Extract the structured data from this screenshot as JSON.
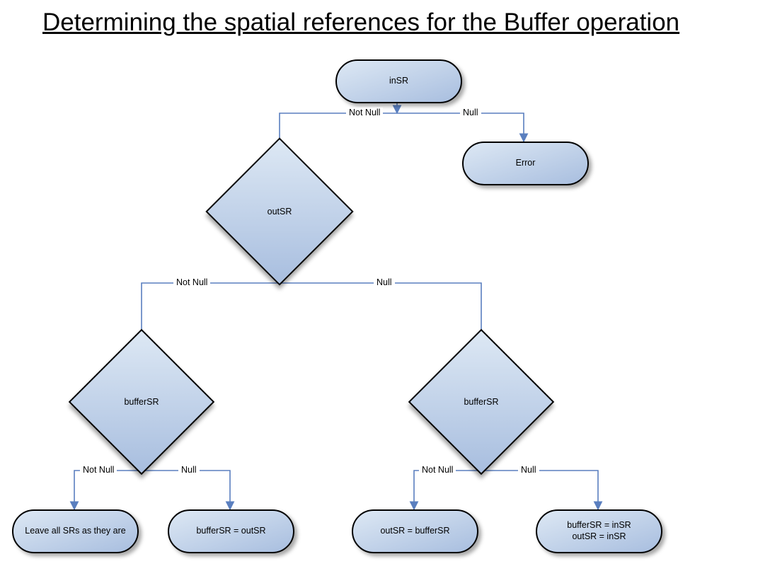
{
  "title": "Determining the spatial references for the Buffer operation",
  "nodes": {
    "inSR": "inSR",
    "error": "Error",
    "outSR": "outSR",
    "bufferSR_left": "bufferSR",
    "bufferSR_right": "bufferSR",
    "leave_all": "Leave all SRs as they are",
    "buf_eq_out": "bufferSR = outSR",
    "out_eq_buf": "outSR = bufferSR",
    "buf_in_out_in_line1": "bufferSR = inSR",
    "buf_in_out_in_line2": "outSR = inSR"
  },
  "edge_labels": {
    "not_null": "Not Null",
    "null": "Null"
  }
}
